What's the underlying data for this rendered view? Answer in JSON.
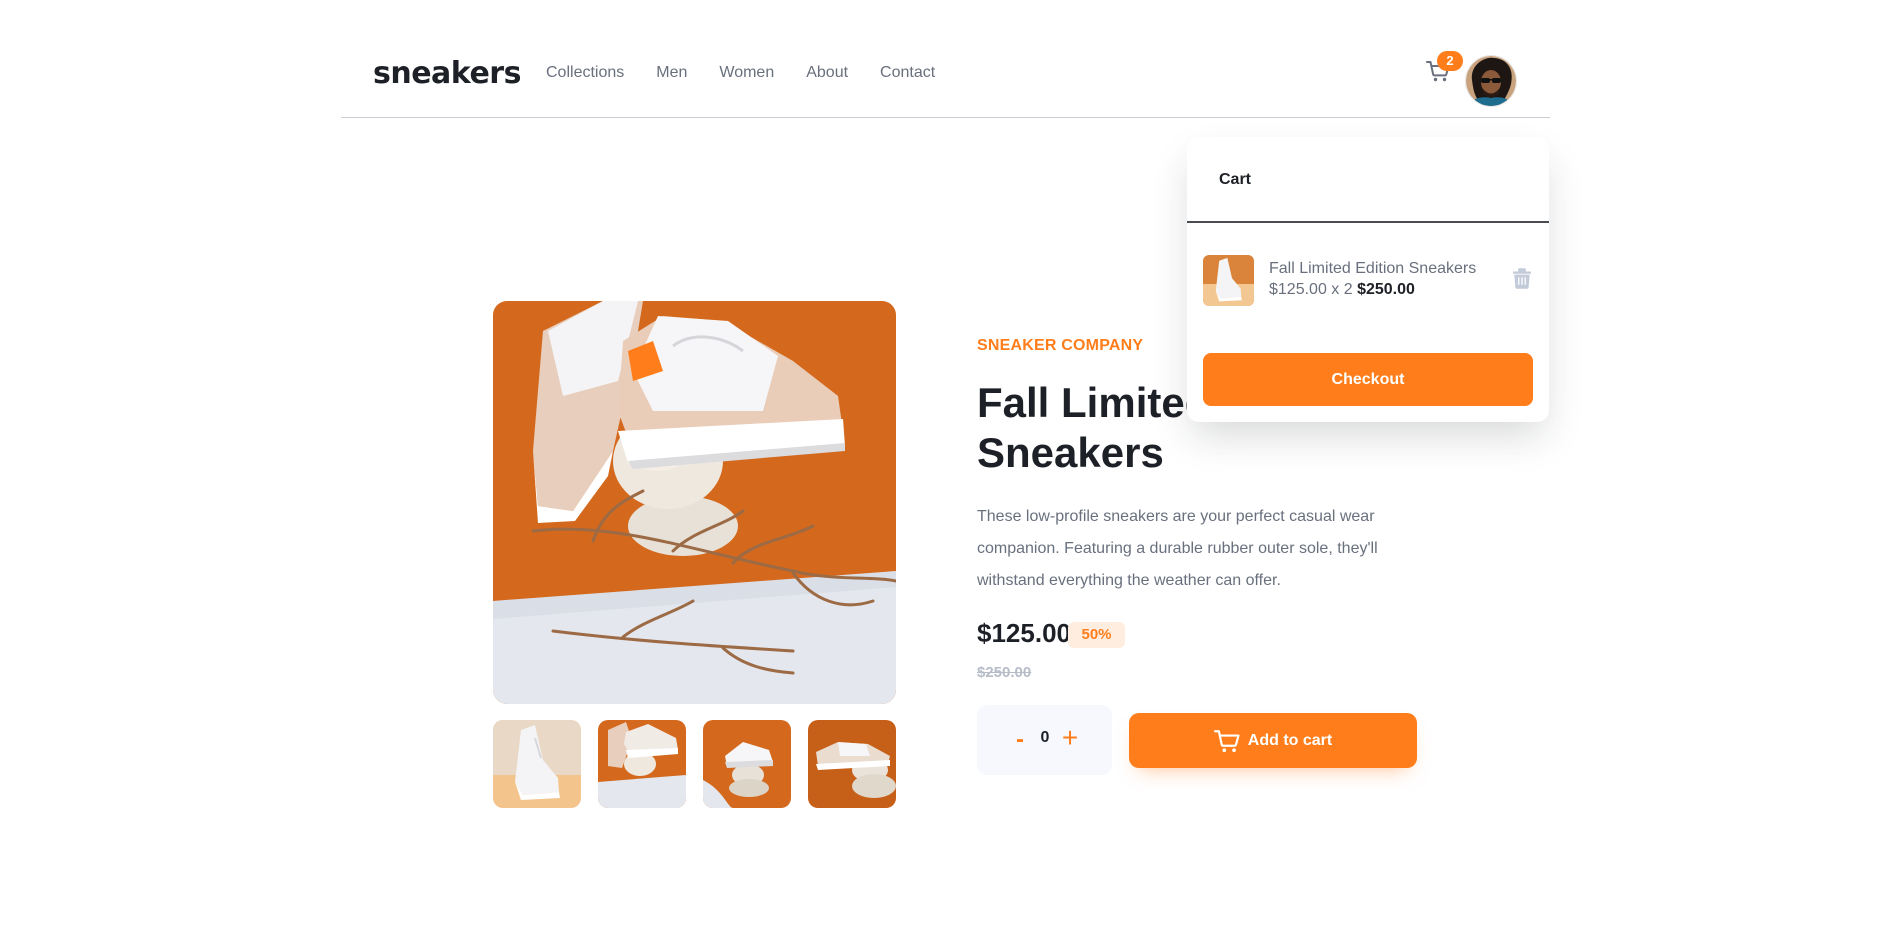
{
  "header": {
    "logo": "sneakers",
    "nav": [
      "Collections",
      "Men",
      "Women",
      "About",
      "Contact"
    ],
    "cart_count": "2",
    "icons": {
      "cart": "cart-icon",
      "avatar": "avatar"
    }
  },
  "gallery": {
    "thumbnails_count": 4
  },
  "product": {
    "company": "SNEAKER COMPANY",
    "title_line1": "Fall Limited",
    "title_line2": "Sneakers",
    "description": "These low-profile sneakers are your perfect casual wear companion. Featuring a durable rubber outer sole, they'll withstand everything the weather can offer.",
    "price": "$125.00",
    "discount": "50%",
    "original_price": "$250.00",
    "quantity": "0",
    "minus_label": "-",
    "plus_label": "+",
    "add_to_cart_label": "Add to cart"
  },
  "cart": {
    "title": "Cart",
    "item": {
      "name": "Fall Limited Edition Sneakers",
      "unit_price_qty": "$125.00 x 2",
      "total": "$250.00"
    },
    "checkout_label": "Checkout"
  },
  "colors": {
    "accent": "#ff7e1b",
    "accent_pale": "#ffede0",
    "dark": "#1d2026",
    "gray": "#69707d",
    "light_gray": "#b6bcc8"
  }
}
